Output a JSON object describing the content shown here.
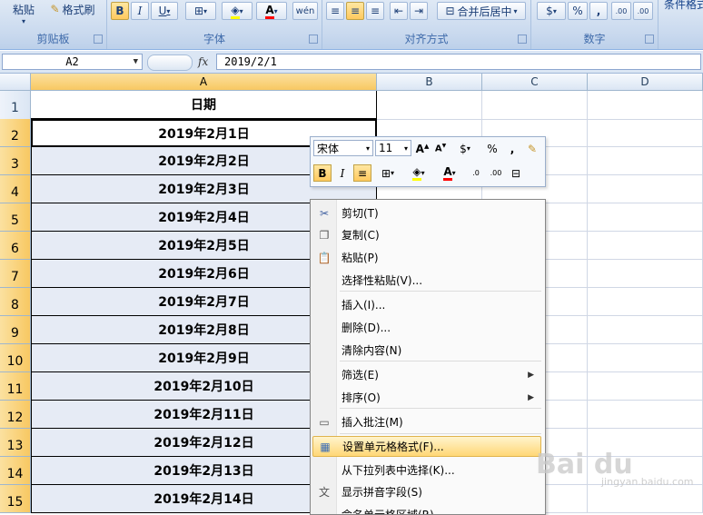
{
  "ribbon": {
    "clipboard": {
      "paste_label": "粘贴",
      "format_painter_label": "格式刷",
      "group_label": "剪贴板"
    },
    "font": {
      "bold": "B",
      "italic": "I",
      "underline": "U",
      "group_label": "字体"
    },
    "alignment": {
      "merge_label": "合并后居中",
      "group_label": "对齐方式"
    },
    "number": {
      "percent": "%",
      "comma": ",",
      "inc_decimal": ".00",
      "dec_decimal": ".00",
      "group_label": "数字"
    },
    "styles": {
      "conditional_label": "条件格式"
    }
  },
  "formula_bar": {
    "name_box": "A2",
    "fx": "fx",
    "value": "2019/2/1"
  },
  "columns": [
    "A",
    "B",
    "C",
    "D"
  ],
  "rows": [
    {
      "num": "1",
      "value": "日期"
    },
    {
      "num": "2",
      "value": "2019年2月1日"
    },
    {
      "num": "3",
      "value": "2019年2月2日"
    },
    {
      "num": "4",
      "value": "2019年2月3日"
    },
    {
      "num": "5",
      "value": "2019年2月4日"
    },
    {
      "num": "6",
      "value": "2019年2月5日"
    },
    {
      "num": "7",
      "value": "2019年2月6日"
    },
    {
      "num": "8",
      "value": "2019年2月7日"
    },
    {
      "num": "9",
      "value": "2019年2月8日"
    },
    {
      "num": "10",
      "value": "2019年2月9日"
    },
    {
      "num": "11",
      "value": "2019年2月10日"
    },
    {
      "num": "12",
      "value": "2019年2月11日"
    },
    {
      "num": "13",
      "value": "2019年2月12日"
    },
    {
      "num": "14",
      "value": "2019年2月13日"
    },
    {
      "num": "15",
      "value": "2019年2月14日"
    }
  ],
  "mini_toolbar": {
    "font_name": "宋体",
    "font_size": "11",
    "percent": "%",
    "comma": ",",
    "bold": "B",
    "italic": "I"
  },
  "context_menu": {
    "items": [
      {
        "label": "剪切(T)",
        "icon": "scissors-icon"
      },
      {
        "label": "复制(C)",
        "icon": "copy-icon"
      },
      {
        "label": "粘贴(P)",
        "icon": "paste-icon"
      },
      {
        "label": "选择性粘贴(V)...",
        "icon": ""
      },
      {
        "label": "插入(I)...",
        "icon": ""
      },
      {
        "label": "删除(D)...",
        "icon": ""
      },
      {
        "label": "清除内容(N)",
        "icon": ""
      },
      {
        "label": "筛选(E)",
        "icon": "",
        "submenu": true
      },
      {
        "label": "排序(O)",
        "icon": "",
        "submenu": true
      },
      {
        "label": "插入批注(M)",
        "icon": "comment-icon"
      },
      {
        "label": "设置单元格格式(F)...",
        "icon": "format-cells-icon",
        "highlighted": true
      },
      {
        "label": "从下拉列表中选择(K)...",
        "icon": ""
      },
      {
        "label": "显示拼音字段(S)",
        "icon": "phonetic-icon"
      },
      {
        "label": "命名单元格区域(R)...",
        "icon": ""
      }
    ]
  },
  "watermark": {
    "brand": "Bai du",
    "sub": "jingyan.baidu.com"
  }
}
